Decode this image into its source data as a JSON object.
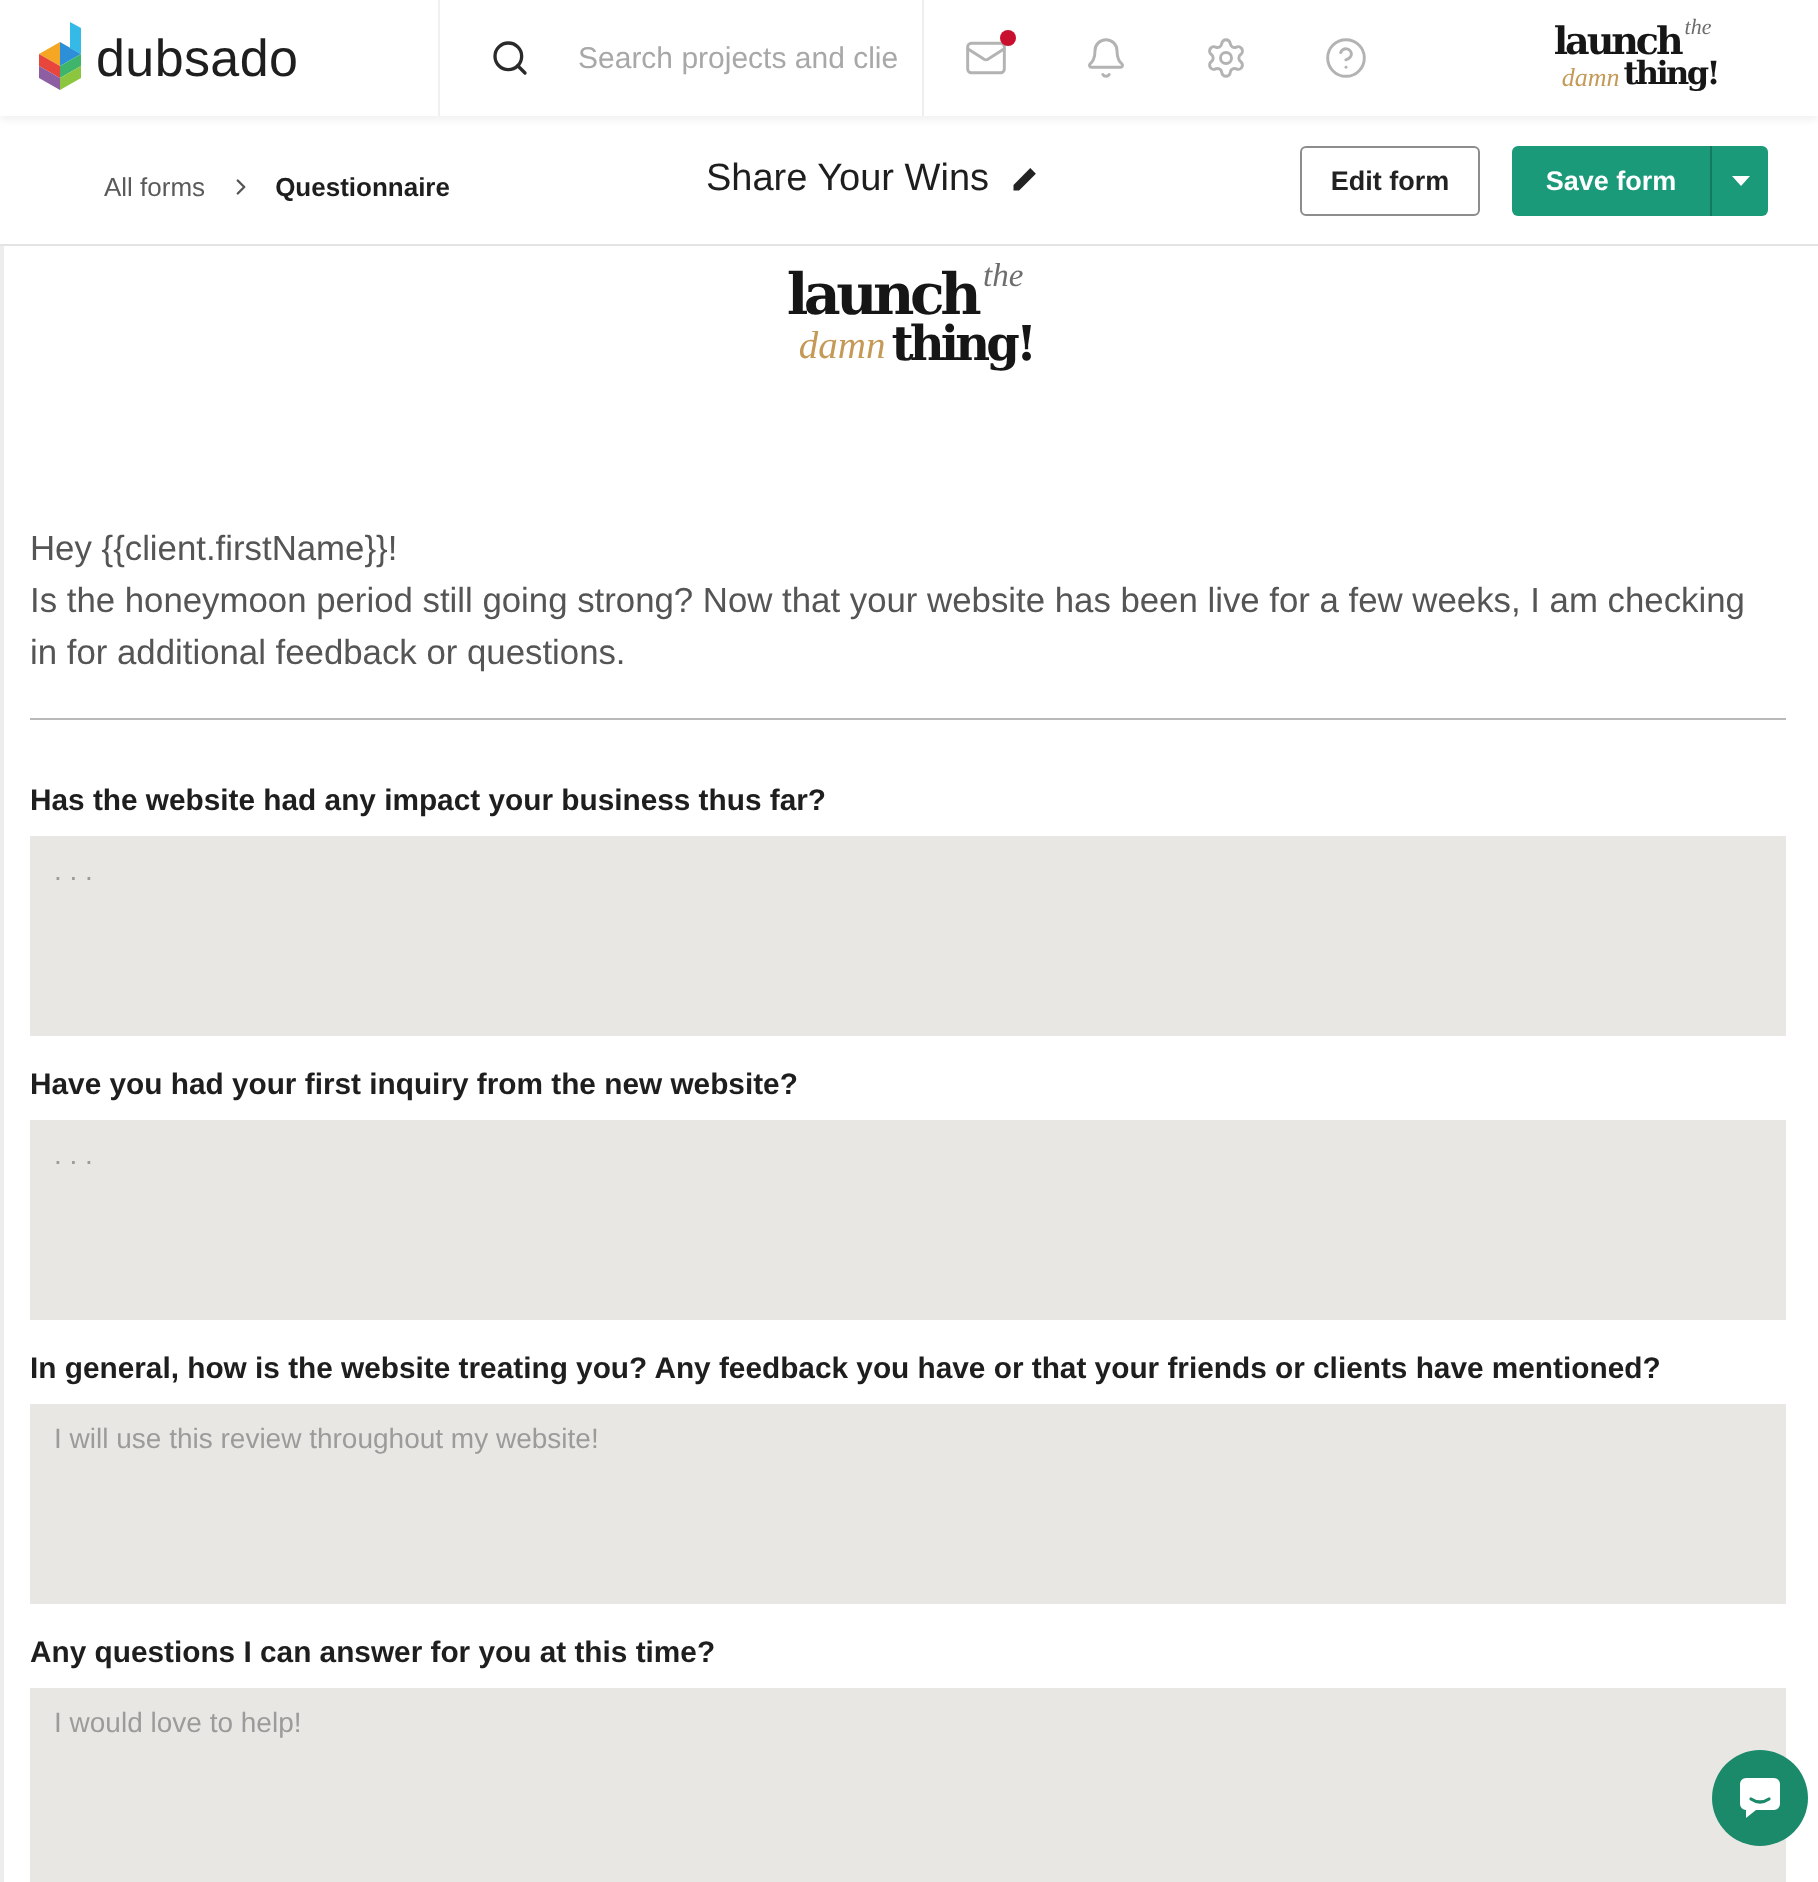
{
  "top_bar": {
    "app_name": "dubsado",
    "search": {
      "placeholder": "Search projects and clie"
    },
    "icons": [
      {
        "kind": "mail",
        "unread": true
      },
      {
        "kind": "bell",
        "unread": false
      },
      {
        "kind": "settings",
        "unread": false
      },
      {
        "kind": "help",
        "unread": false
      }
    ],
    "brand_logo": {
      "top": "launch",
      "superscript": "the",
      "script": "damn",
      "bottom": "thing!"
    }
  },
  "form_header": {
    "breadcrumb": [
      {
        "label": "All forms",
        "current": false
      },
      {
        "label": "Questionnaire",
        "current": true
      }
    ],
    "title": "Share Your Wins",
    "buttons": [
      {
        "label": "Edit form",
        "kind": "outline"
      },
      {
        "label": "Save form",
        "kind": "split"
      }
    ]
  },
  "form": {
    "brand_logo": {
      "top": "launch",
      "superscript": "the",
      "script": "damn",
      "bottom": "thing!"
    },
    "greeting": "Hey {{client.firstName}}!",
    "intro": "Is the honeymoon period still going strong? Now that your website has been live for a few weeks, I am checking in for additional feedback or questions.",
    "questions": [
      {
        "label": "Has the website had any impact your business thus far?",
        "placeholder": ". . ."
      },
      {
        "label": "Have you had your first inquiry from the new website?",
        "placeholder": ". . ."
      },
      {
        "label": "In general, how is the website treating you? Any feedback you have or that your friends or clients have mentioned?",
        "placeholder": "I will use this review throughout my website!"
      },
      {
        "label": "Any questions I can answer for you at this time?",
        "placeholder": "I would love to help!"
      }
    ]
  }
}
